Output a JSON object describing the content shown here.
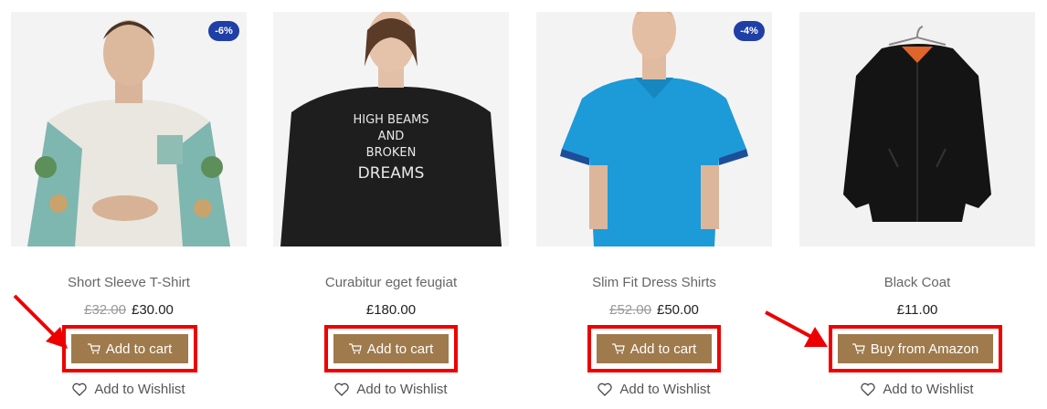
{
  "products": [
    {
      "title": "Short Sleeve T-Shirt",
      "old_price": "£32.00",
      "price": "£30.00",
      "badge": "-6%",
      "button_label": "Add to cart",
      "wishlist_label": "Add to Wishlist"
    },
    {
      "title": "Curabitur eget feugiat",
      "old_price": "",
      "price": "£180.00",
      "badge": "",
      "shirt_print": [
        "HIGH BEAMS",
        "AND",
        "BROKEN",
        "DREAMS"
      ],
      "button_label": "Add to cart",
      "wishlist_label": "Add to Wishlist"
    },
    {
      "title": "Slim Fit Dress Shirts",
      "old_price": "£52.00",
      "price": "£50.00",
      "badge": "-4%",
      "button_label": "Add to cart",
      "wishlist_label": "Add to Wishlist"
    },
    {
      "title": "Black Coat",
      "old_price": "",
      "price": "£11.00",
      "badge": "",
      "button_label": "Buy from Amazon",
      "wishlist_label": "Add to Wishlist"
    }
  ],
  "colors": {
    "button": "#9f7a4c",
    "highlight": "#ee0000",
    "badge": "#1f3fa6"
  }
}
